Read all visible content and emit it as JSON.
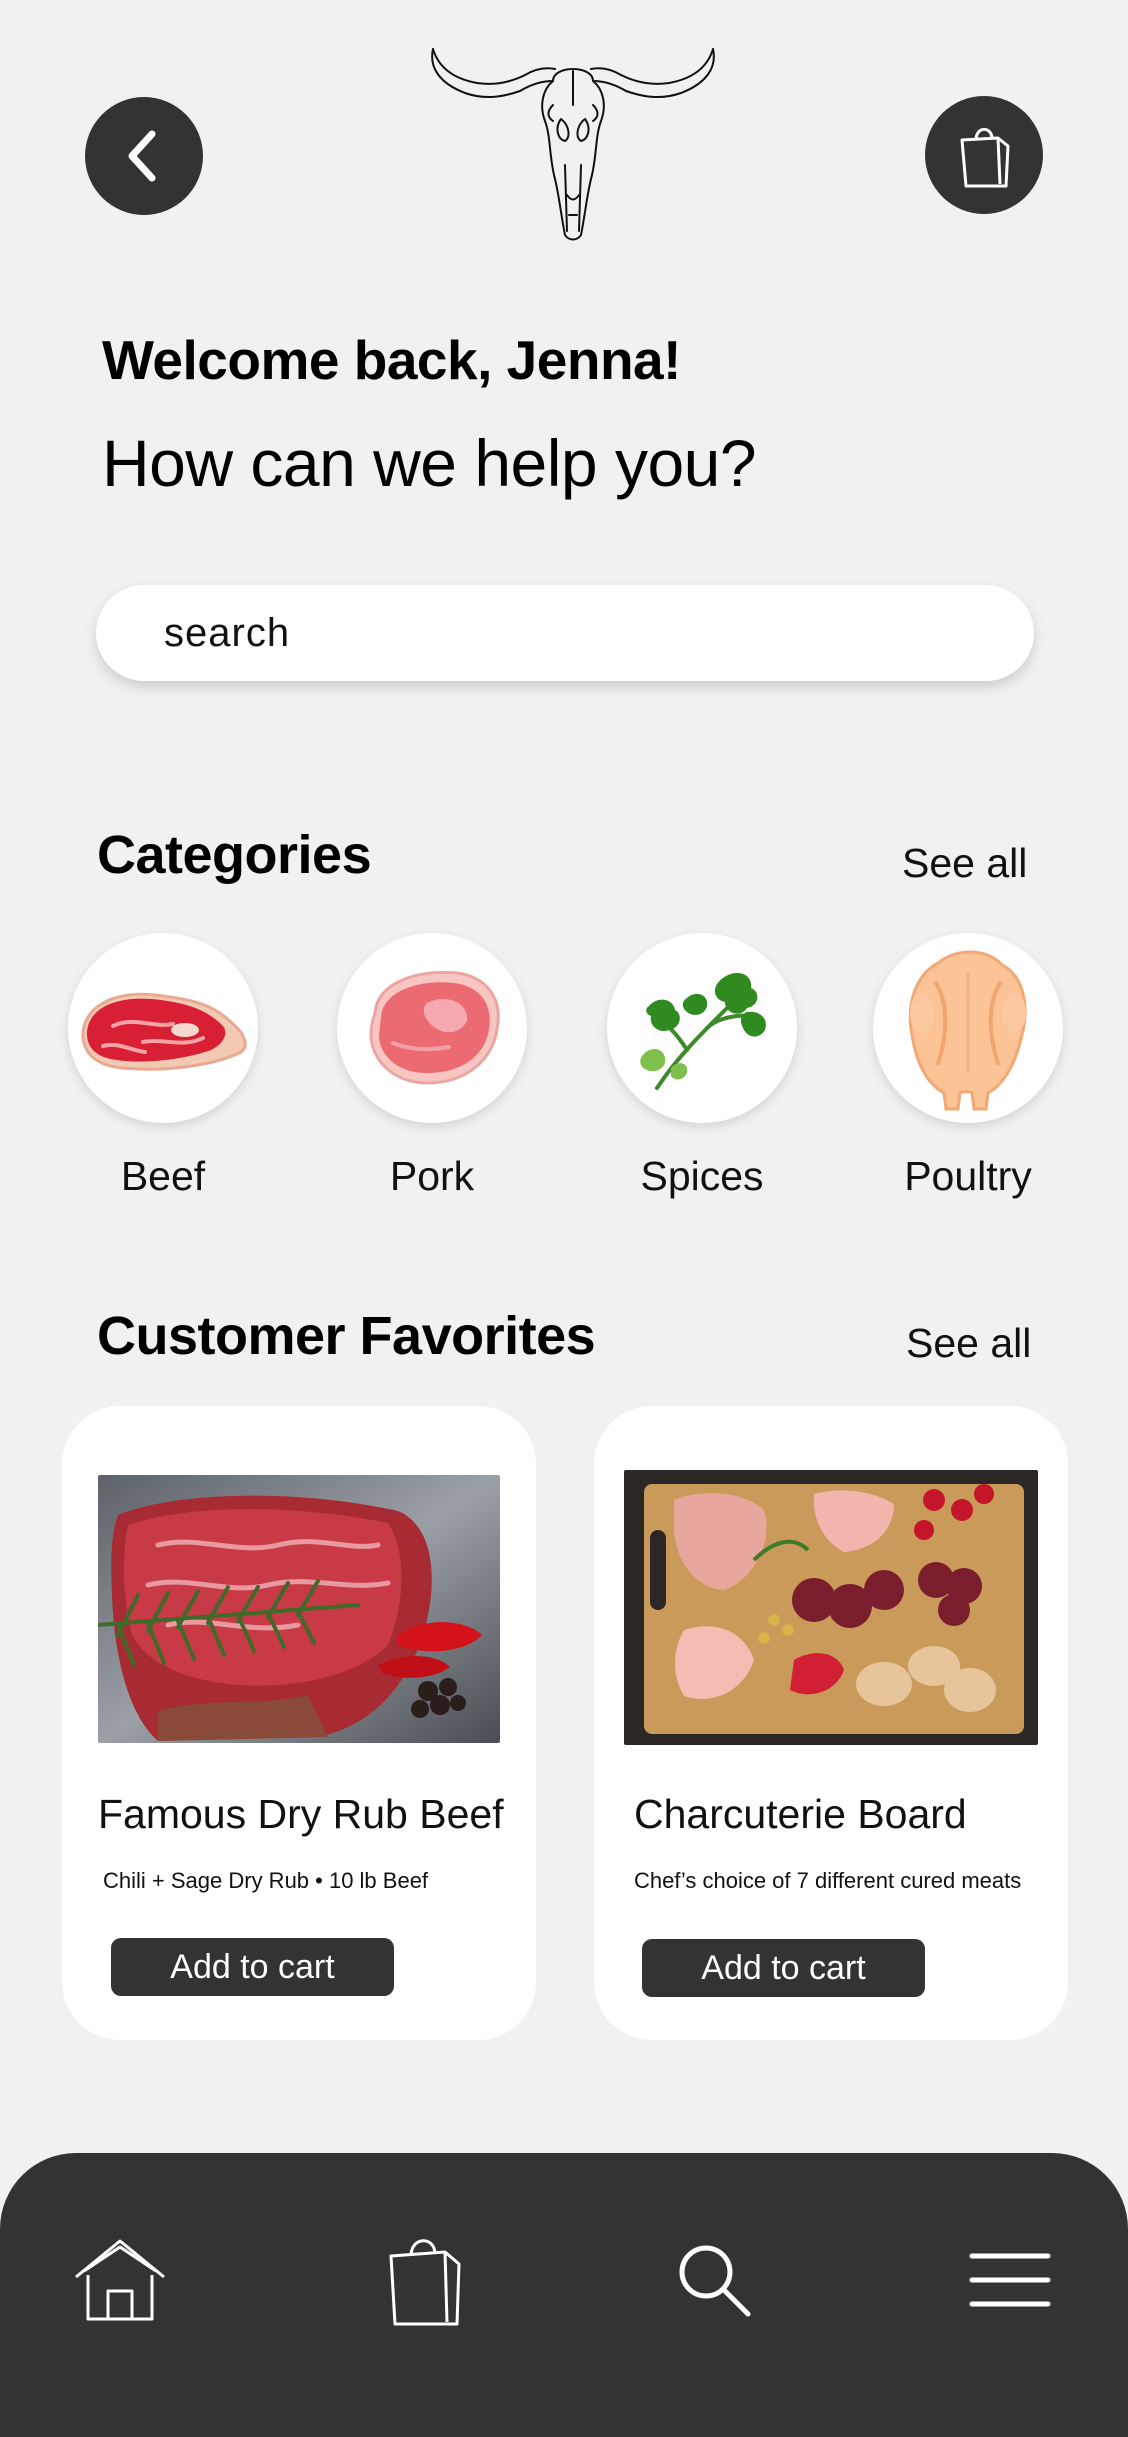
{
  "header": {
    "back_icon": "chevron-left-icon",
    "logo_icon": "bull-skull-icon",
    "bag_icon": "shopping-bag-icon"
  },
  "greeting": {
    "welcome": "Welcome back, Jenna!",
    "subtitle": "How can we help you?"
  },
  "search": {
    "placeholder": "search"
  },
  "categories": {
    "title": "Categories",
    "see_all": "See all",
    "items": [
      {
        "label": "Beef",
        "icon": "beef-steak-icon"
      },
      {
        "label": "Pork",
        "icon": "pork-chop-icon"
      },
      {
        "label": "Spices",
        "icon": "parsley-icon"
      },
      {
        "label": "Poultry",
        "icon": "chicken-icon"
      }
    ]
  },
  "favorites": {
    "title": "Customer Favorites",
    "see_all": "See all",
    "items": [
      {
        "title": "Famous Dry Rub Beef",
        "description": "Chili + Sage Dry Rub  • 10 lb Beef",
        "button": "Add to cart",
        "image": "raw-beef-steak-photo"
      },
      {
        "title": "Charcuterie Board",
        "description": "Chef’s choice of 7 different cured meats",
        "button": "Add to cart",
        "image": "charcuterie-board-photo"
      }
    ]
  },
  "bottom_nav": {
    "items": [
      {
        "icon": "home-icon"
      },
      {
        "icon": "shopping-bag-icon"
      },
      {
        "icon": "search-icon"
      },
      {
        "icon": "menu-icon"
      }
    ]
  },
  "colors": {
    "background": "#f1f1f1",
    "dark": "#333333",
    "card": "#ffffff"
  }
}
